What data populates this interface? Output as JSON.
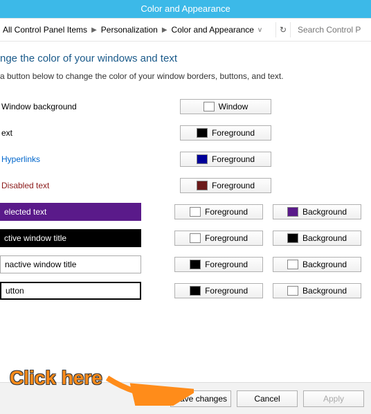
{
  "window": {
    "title": "Color and Appearance"
  },
  "breadcrumb": {
    "items": [
      "All Control Panel Items",
      "Personalization",
      "Color and Appearance"
    ],
    "search_placeholder": "Search Control P"
  },
  "main": {
    "heading": "nge the color of your windows and text",
    "sub": "a button below to change the color of your window borders, buttons, and text."
  },
  "rows": [
    {
      "label": "Window background",
      "label_style": "plain",
      "label_color": "#000",
      "buttons": [
        {
          "text": "Window",
          "swatch": "#ffffff"
        }
      ]
    },
    {
      "label": "ext",
      "label_style": "plain",
      "label_color": "#000",
      "buttons": [
        {
          "text": "Foreground",
          "swatch": "#000000"
        }
      ]
    },
    {
      "label": "Hyperlinks",
      "label_style": "plain",
      "label_color": "#0066cc",
      "buttons": [
        {
          "text": "Foreground",
          "swatch": "#000099"
        }
      ]
    },
    {
      "label": "Disabled text",
      "label_style": "plain",
      "label_color": "#8b1a1a",
      "buttons": [
        {
          "text": "Foreground",
          "swatch": "#6b1a1a"
        }
      ]
    },
    {
      "label": "elected text",
      "label_style": "sel",
      "label_color": "#fff",
      "buttons": [
        {
          "text": "Foreground",
          "swatch": "#ffffff"
        },
        {
          "text": "Background",
          "swatch": "#5a1a8a"
        }
      ]
    },
    {
      "label": "ctive window title",
      "label_style": "active-t",
      "label_color": "#fff",
      "buttons": [
        {
          "text": "Foreground",
          "swatch": "#ffffff"
        },
        {
          "text": "Background",
          "swatch": "#000000"
        }
      ]
    },
    {
      "label": "nactive window title",
      "label_style": "inactive-t",
      "label_color": "#000",
      "buttons": [
        {
          "text": "Foreground",
          "swatch": "#000000"
        },
        {
          "text": "Background",
          "swatch": "#ffffff"
        }
      ]
    },
    {
      "label": "utton",
      "label_style": "btn-l",
      "label_color": "#000",
      "buttons": [
        {
          "text": "Foreground",
          "swatch": "#000000"
        },
        {
          "text": "Background",
          "swatch": "#ffffff"
        }
      ]
    }
  ],
  "footer": {
    "save": "Save changes",
    "cancel": "Cancel",
    "apply": "Apply"
  },
  "callout": {
    "text": "Click here"
  }
}
